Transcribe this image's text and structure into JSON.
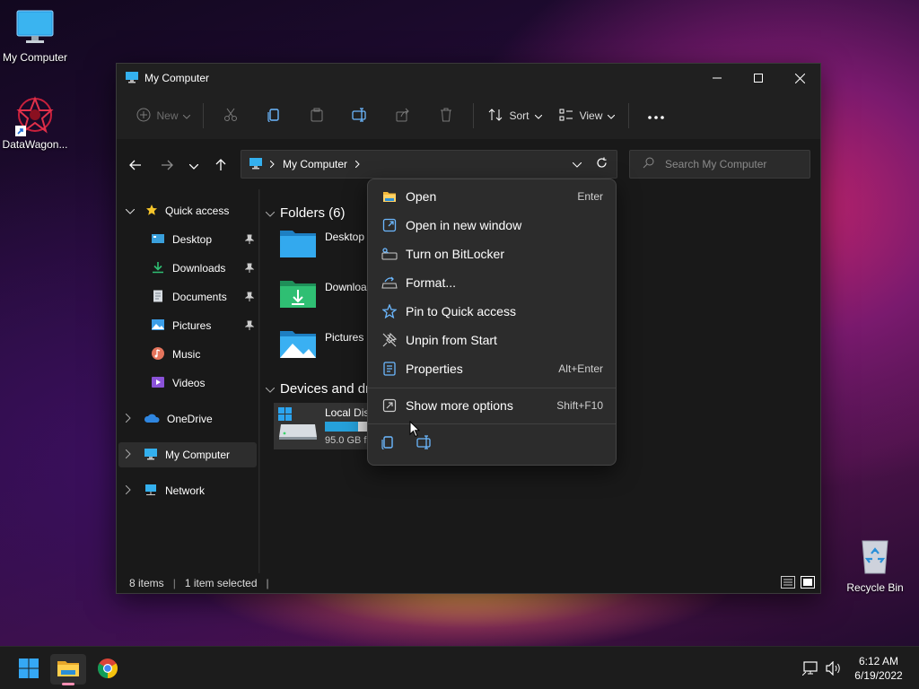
{
  "desktop": {
    "icons": [
      {
        "label": "My Computer",
        "icon": "monitor-icon"
      },
      {
        "label": "DataWagon...",
        "icon": "datawagon-shortcut-icon"
      },
      {
        "label": "Recycle Bin",
        "icon": "recycle-bin-icon"
      }
    ]
  },
  "window": {
    "title": "My Computer",
    "toolbar": {
      "new_label": "New",
      "sort_label": "Sort",
      "view_label": "View"
    },
    "address": {
      "path_label": "My Computer"
    },
    "search": {
      "placeholder": "Search My Computer"
    },
    "sidebar": {
      "quick_access": "Quick access",
      "items": [
        {
          "label": "Desktop",
          "icon": "desktop-folder-icon",
          "pinned": true
        },
        {
          "label": "Downloads",
          "icon": "downloads-icon",
          "pinned": true
        },
        {
          "label": "Documents",
          "icon": "documents-icon",
          "pinned": true
        },
        {
          "label": "Pictures",
          "icon": "pictures-icon",
          "pinned": true
        },
        {
          "label": "Music",
          "icon": "music-icon",
          "pinned": false
        },
        {
          "label": "Videos",
          "icon": "videos-icon",
          "pinned": false
        }
      ],
      "onedrive": "OneDrive",
      "mycomputer": "My Computer",
      "network": "Network"
    },
    "content": {
      "folders_header": "Folders (6)",
      "folders": [
        {
          "label": "Desktop",
          "icon": "desktop-folder-icon"
        },
        {
          "label": "Downloa",
          "icon": "downloads-folder-icon"
        },
        {
          "label": "Pictures",
          "icon": "pictures-folder-icon"
        }
      ],
      "devices_header": "Devices and dr",
      "drive": {
        "label": "Local Dis",
        "free": "95.0 GB fr",
        "used_fraction": 0.78
      }
    },
    "status": {
      "items": "8 items",
      "selected": "1 item selected"
    }
  },
  "context_menu": {
    "items": [
      {
        "label": "Open",
        "shortcut": "Enter",
        "icon": "folder-open-icon"
      },
      {
        "label": "Open in new window",
        "shortcut": "",
        "icon": "open-new-window-icon"
      },
      {
        "label": "Turn on BitLocker",
        "shortcut": "",
        "icon": "bitlocker-key-icon"
      },
      {
        "label": "Format...",
        "shortcut": "",
        "icon": "format-drive-icon"
      },
      {
        "label": "Pin to Quick access",
        "shortcut": "",
        "icon": "star-pin-icon"
      },
      {
        "label": "Unpin from Start",
        "shortcut": "",
        "icon": "unpin-icon"
      },
      {
        "label": "Properties",
        "shortcut": "Alt+Enter",
        "icon": "properties-icon"
      }
    ],
    "more": {
      "label": "Show more options",
      "shortcut": "Shift+F10",
      "icon": "more-options-icon"
    },
    "bottom_icons": [
      "copy-icon",
      "rename-icon"
    ]
  },
  "taskbar": {
    "time": "6:12 AM",
    "date": "6/19/2022"
  }
}
